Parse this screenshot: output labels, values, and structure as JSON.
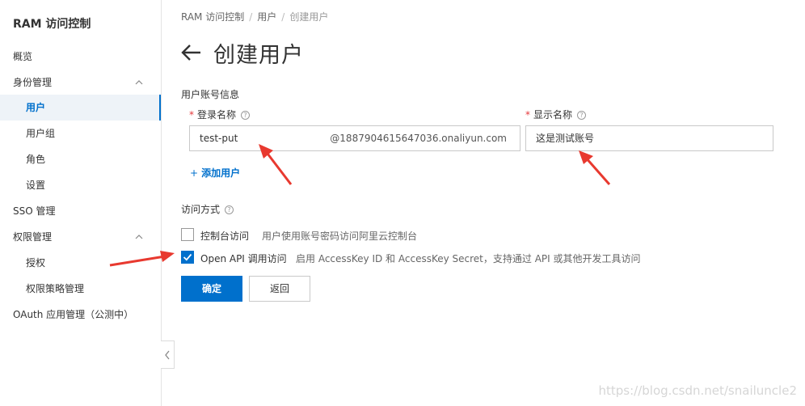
{
  "sidebar": {
    "title": "RAM 访问控制",
    "items": [
      {
        "label": "概览"
      },
      {
        "label": "身份管理"
      },
      {
        "label": "用户"
      },
      {
        "label": "用户组"
      },
      {
        "label": "角色"
      },
      {
        "label": "设置"
      },
      {
        "label": "SSO 管理"
      },
      {
        "label": "权限管理"
      },
      {
        "label": "授权"
      },
      {
        "label": "权限策略管理"
      },
      {
        "label": "OAuth 应用管理（公测中）"
      }
    ]
  },
  "breadcrumb": [
    "RAM 访问控制",
    "用户",
    "创建用户"
  ],
  "page": {
    "title": "创建用户"
  },
  "form": {
    "section_label": "用户账号信息",
    "login_name_label": "登录名称",
    "login_name_value": "test-put",
    "login_suffix": "@1887904615647036.onaliyun.com",
    "display_name_label": "显示名称",
    "display_name_value": "这是测试账号",
    "add_user_label": "添加用户",
    "add_user_plus": "+",
    "access_label": "访问方式",
    "options": [
      {
        "label": "控制台访问",
        "desc": "用户使用账号密码访问阿里云控制台",
        "checked": false
      },
      {
        "label": "Open API 调用访问",
        "desc": "启用 AccessKey ID 和 AccessKey Secret，支持通过 API 或其他开发工具访问",
        "checked": true
      }
    ],
    "confirm_label": "确定",
    "back_label": "返回"
  },
  "watermark": "https://blog.csdn.net/snailuncle2",
  "colors": {
    "accent": "#0070cc",
    "annotation": "#e8392f",
    "required": "#e4393c"
  }
}
